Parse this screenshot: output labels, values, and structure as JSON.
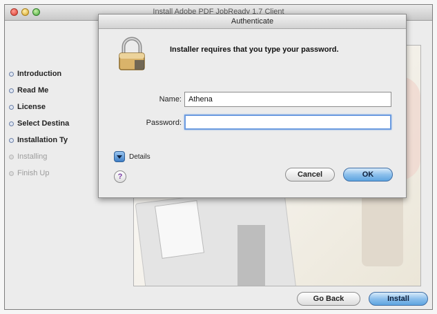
{
  "window": {
    "title": "Install Adobe PDF JobReady 1.7 Client"
  },
  "steps": [
    {
      "label": "Introduction",
      "state": "done"
    },
    {
      "label": "Read Me",
      "state": "done"
    },
    {
      "label": "License",
      "state": "done"
    },
    {
      "label": "Select Destina",
      "state": "done"
    },
    {
      "label": "Installation Ty",
      "state": "current"
    },
    {
      "label": "Installing",
      "state": "pending"
    },
    {
      "label": "Finish Up",
      "state": "pending"
    }
  ],
  "installer_buttons": {
    "go_back": "Go Back",
    "install": "Install"
  },
  "auth": {
    "title": "Authenticate",
    "prompt": "Installer requires that you type your password.",
    "name_label": "Name:",
    "name_value": "Athena",
    "password_label": "Password:",
    "password_value": "",
    "details_label": "Details",
    "help_label": "?",
    "cancel_label": "Cancel",
    "ok_label": "OK"
  },
  "colors": {
    "accent": "#5ea4e0",
    "focus_ring": "#6b9be0"
  }
}
